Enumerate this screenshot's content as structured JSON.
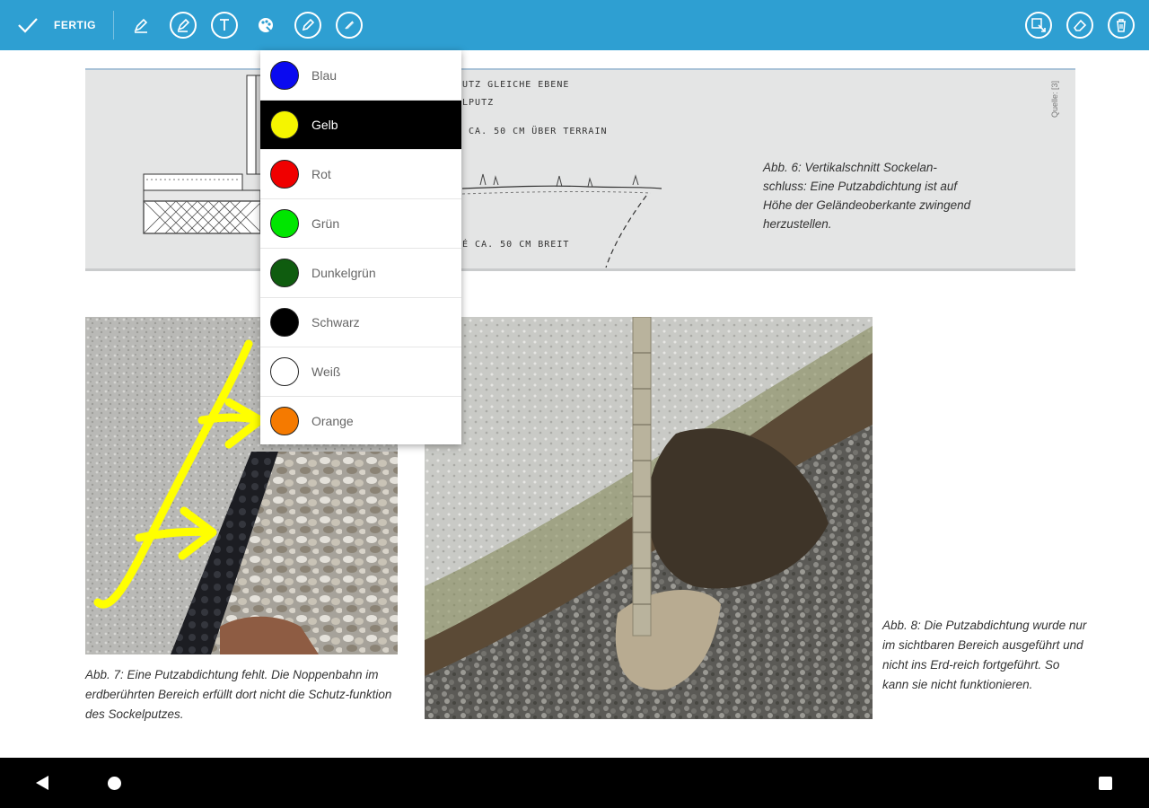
{
  "toolbar": {
    "done_label": "FERTIG",
    "left_icons": [
      "marker-pen-icon",
      "highlighter-icon",
      "text-tool-icon",
      "color-palette-icon",
      "pencil-icon",
      "fine-pencil-icon"
    ],
    "right_icons": [
      "select-area-icon",
      "eraser-icon",
      "trash-icon"
    ],
    "color": "#2e9fd2"
  },
  "figure6": {
    "drawing_labels": [
      "PUTZ  GLEICHE  EBENE",
      "ELPUTZ",
      "Z  CA. 50 CM  ÜBER  TERRAIN",
      "NÉ  CA. 50 CM  BREIT",
      "T"
    ],
    "caption": "Abb. 6: Vertikalschnitt Sockelan-schluss: Eine Putzabdichtung ist auf Höhe der Geländeoberkante zwingend herzustellen.",
    "source_label": "Quelle: [3]"
  },
  "figure7": {
    "caption": "Abb. 7: Eine Putzabdichtung fehlt. Die Noppenbahn im erdberührten Bereich erfüllt dort nicht die Schutz-funktion des Sockelputzes."
  },
  "figure8": {
    "caption": "Abb. 8: Die Putzabdichtung wurde nur im sichtbaren Bereich ausgeführt und nicht ins Erd-reich fortgeführt. So kann sie nicht funktionieren."
  },
  "color_menu": {
    "selected": "Gelb",
    "items": [
      {
        "label": "Blau",
        "color": "#0a0af0"
      },
      {
        "label": "Gelb",
        "color": "#f5f500"
      },
      {
        "label": "Rot",
        "color": "#f00000"
      },
      {
        "label": "Grün",
        "color": "#00e600"
      },
      {
        "label": "Dunkelgrün",
        "color": "#0f5c0f"
      },
      {
        "label": "Schwarz",
        "color": "#000000"
      },
      {
        "label": "Weiß",
        "color": "#ffffff"
      },
      {
        "label": "Orange",
        "color": "#f57a00"
      }
    ]
  },
  "annotation": {
    "color": "#ffff00"
  },
  "navbar": {
    "icons": [
      "back-icon",
      "home-icon",
      "recents-icon"
    ]
  }
}
